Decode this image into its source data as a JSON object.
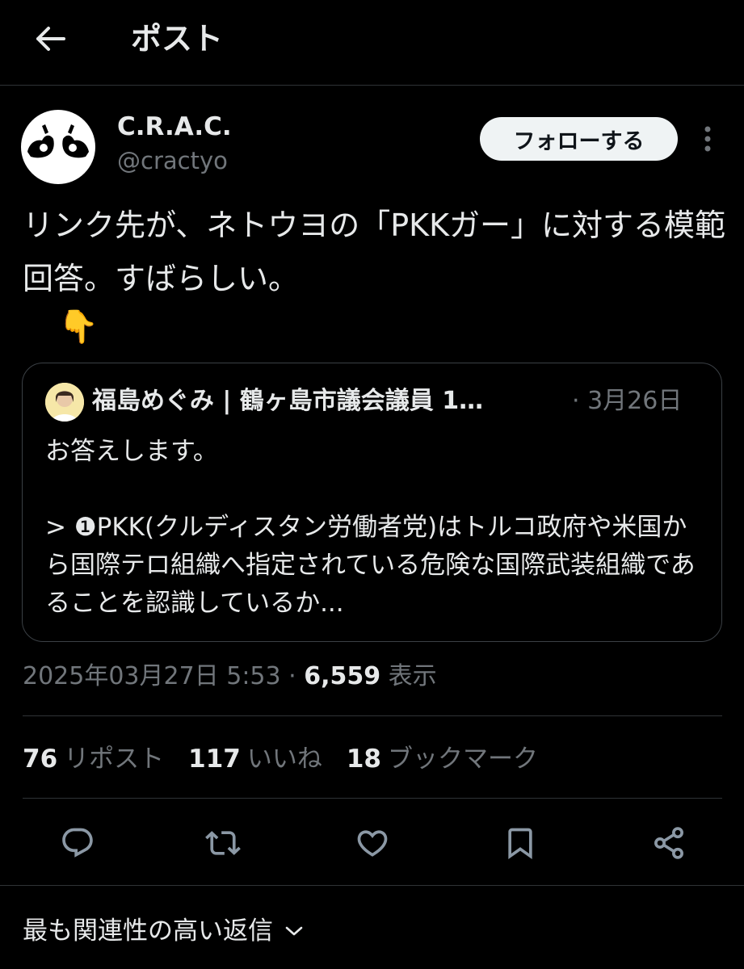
{
  "header": {
    "title": "ポスト"
  },
  "author": {
    "name": "C.R.A.C.",
    "handle": "@cractyo"
  },
  "follow_button": "フォローする",
  "tweet": {
    "text": "リンク先が、ネトウヨの「PKKガー」に対する模範回答。すばらしい。",
    "emoji": "👇"
  },
  "quote": {
    "author_name": "福島めぐみ | 鶴ヶ島市議会議員 1…",
    "meta": "· 3月26日",
    "text": "お答えします。\n\n> ❶PKK(クルディスタン労働者党)はトルコ政府や米国から国際テロ組織へ指定されている危険な国際武装組織であることを認識しているか..."
  },
  "timestamp": {
    "datetime": "2025年03月27日 5:53",
    "sep": " · ",
    "views": "6,559",
    "views_label": "表示"
  },
  "stats": [
    {
      "num": "76",
      "label": "リポスト"
    },
    {
      "num": "117",
      "label": "いいね"
    },
    {
      "num": "18",
      "label": "ブックマーク"
    }
  ],
  "actions": [
    "reply-icon",
    "repost-icon",
    "like-icon",
    "bookmark-icon",
    "share-icon"
  ],
  "sort": {
    "label": "最も関連性の高い返信"
  },
  "colors": {
    "background": "#000000",
    "text": "#e7e9ea",
    "muted": "#71767b",
    "border": "#2f3336"
  }
}
